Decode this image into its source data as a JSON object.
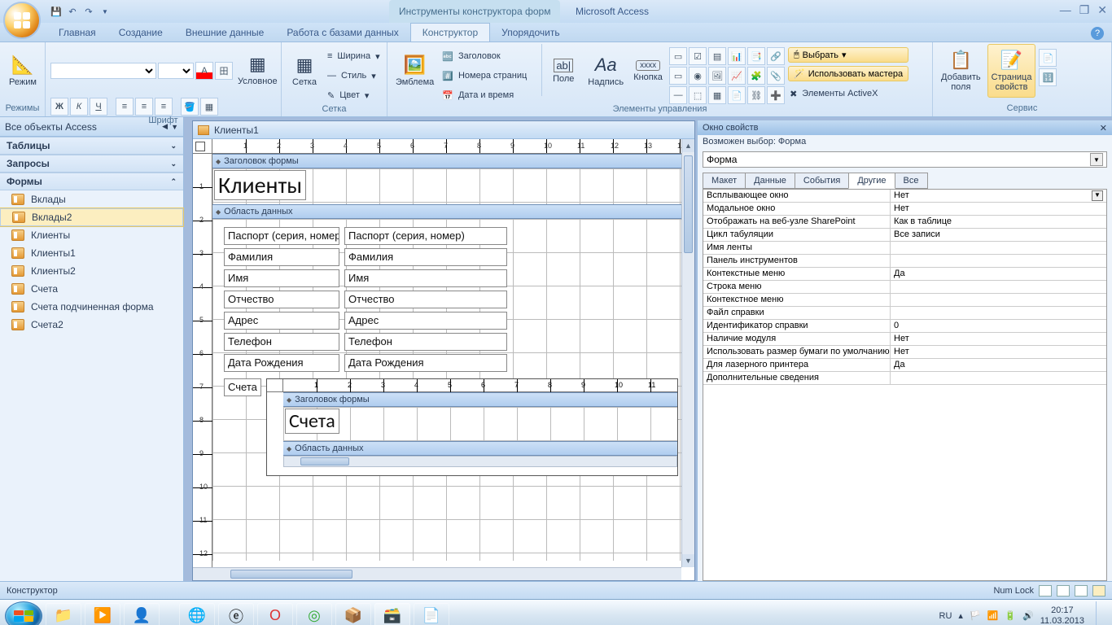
{
  "app": {
    "title": "Microsoft Access",
    "context_title": "Инструменты конструктора форм"
  },
  "win_buttons": {
    "min": "—",
    "max": "❐",
    "close": "✕"
  },
  "tabs": {
    "home": "Главная",
    "create": "Создание",
    "external": "Внешние данные",
    "dbtools": "Работа с базами данных",
    "designer": "Конструктор",
    "arrange": "Упорядочить"
  },
  "ribbon": {
    "modes_group": "Режимы",
    "mode_btn": "Режим",
    "font_group": "Шрифт",
    "bold": "Ж",
    "italic": "К",
    "underline": "Ч",
    "cond_btn": "Условное",
    "grid_group": "Сетка",
    "grid_btn": "Сетка",
    "width_btn": "Ширина",
    "style_btn": "Стиль",
    "color_btn": "Цвет",
    "emblem_btn": "Эмблема",
    "title_chk": "Заголовок",
    "pages_chk": "Номера страниц",
    "datetime_chk": "Дата и время",
    "controls_group": "Элементы управления",
    "field_btn": "Поле",
    "label_btn": "Надпись",
    "button_btn": "Кнопка",
    "select_btn": "Выбрать",
    "wizard_btn": "Использовать мастера",
    "activex_btn": "Элементы ActiveX",
    "addfields_btn": "Добавить\nполя",
    "propsheet_btn": "Страница\nсвойств",
    "service_group": "Сервис"
  },
  "nav": {
    "header": "Все объекты Access",
    "groups": {
      "tables": "Таблицы",
      "queries": "Запросы",
      "forms": "Формы"
    },
    "forms": [
      "Вклады",
      "Вклады2",
      "Клиенты",
      "Клиенты1",
      "Клиенты2",
      "Счета",
      "Счета подчиненная форма",
      "Счета2"
    ],
    "selected": "Вклады2"
  },
  "form": {
    "tab_title": "Клиенты1",
    "header_section": "Заголовок формы",
    "detail_section": "Область данных",
    "title_label": "Клиенты",
    "fields": [
      {
        "label": "Паспорт (серия, номер)",
        "box": "Паспорт (серия, номер)"
      },
      {
        "label": "Фамилия",
        "box": "Фамилия"
      },
      {
        "label": "Имя",
        "box": "Имя"
      },
      {
        "label": "Отчество",
        "box": "Отчество"
      },
      {
        "label": "Адрес",
        "box": "Адрес"
      },
      {
        "label": "Телефон",
        "box": "Телефон"
      },
      {
        "label": "Дата Рождения",
        "box": "Дата Рождения"
      }
    ],
    "subform_label": "Счета",
    "sub_header_section": "Заголовок формы",
    "sub_title": "Счета",
    "sub_detail_section": "Область данных"
  },
  "props": {
    "pane_title": "Окно свойств",
    "selection_label": "Возможен выбор:  Форма",
    "combo": "Форма",
    "tabs": {
      "layout": "Макет",
      "data": "Данные",
      "events": "События",
      "other": "Другие",
      "all": "Все"
    },
    "rows": [
      {
        "k": "Всплывающее окно",
        "v": "Нет"
      },
      {
        "k": "Модальное окно",
        "v": "Нет"
      },
      {
        "k": "Отображать на веб-узле SharePoint",
        "v": "Как в таблице"
      },
      {
        "k": "Цикл табуляции",
        "v": "Все записи"
      },
      {
        "k": "Имя ленты",
        "v": ""
      },
      {
        "k": "Панель инструментов",
        "v": ""
      },
      {
        "k": "Контекстные меню",
        "v": "Да"
      },
      {
        "k": "Строка меню",
        "v": ""
      },
      {
        "k": "Контекстное меню",
        "v": ""
      },
      {
        "k": "Файл справки",
        "v": ""
      },
      {
        "k": "Идентификатор справки",
        "v": "0"
      },
      {
        "k": "Наличие модуля",
        "v": "Нет"
      },
      {
        "k": "Использовать размер бумаги по умолчанию",
        "v": "Нет"
      },
      {
        "k": "Для лазерного принтера",
        "v": "Да"
      },
      {
        "k": "Дополнительные сведения",
        "v": ""
      }
    ]
  },
  "status": {
    "left": "Конструктор",
    "numlock": "Num Lock"
  },
  "tray": {
    "lang": "RU",
    "time": "20:17",
    "date": "11.03.2013"
  }
}
